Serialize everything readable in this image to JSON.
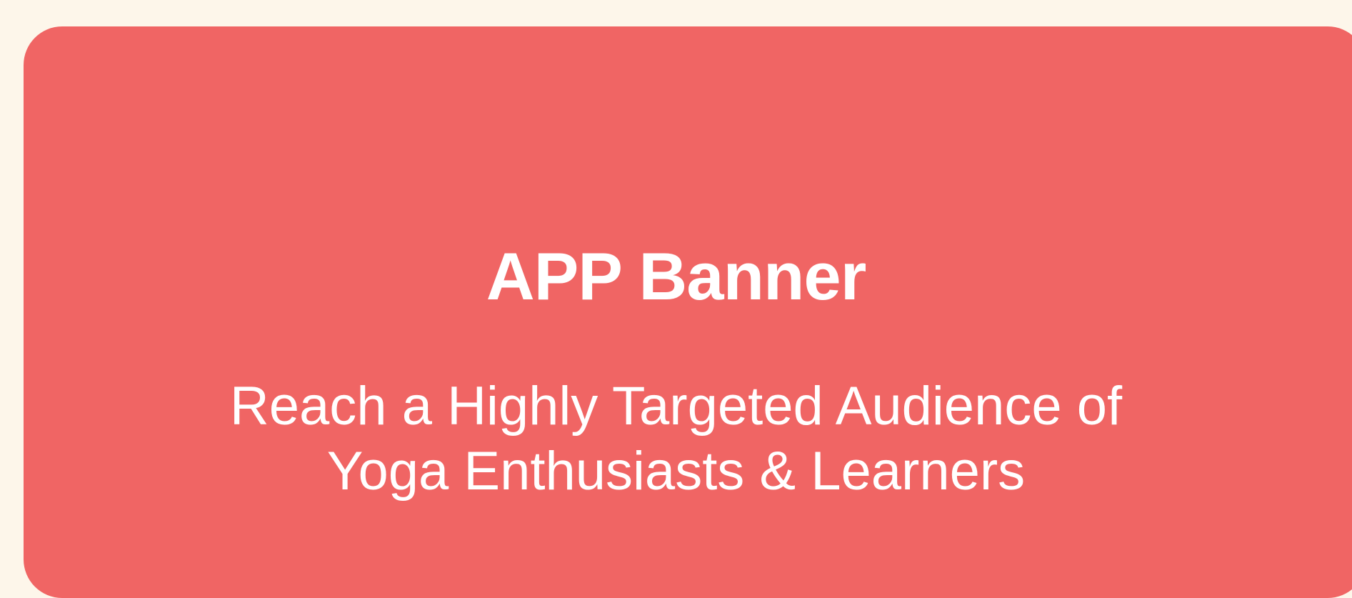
{
  "banner": {
    "title": "APP Banner",
    "subtitle_lines": [
      "Reach a Highly Targeted Audience of",
      "Yoga Enthusiasts & Learners"
    ]
  },
  "colors": {
    "page_background": "#FDF6EA",
    "banner_background": "#F06564",
    "text": "#FFFFFF"
  }
}
